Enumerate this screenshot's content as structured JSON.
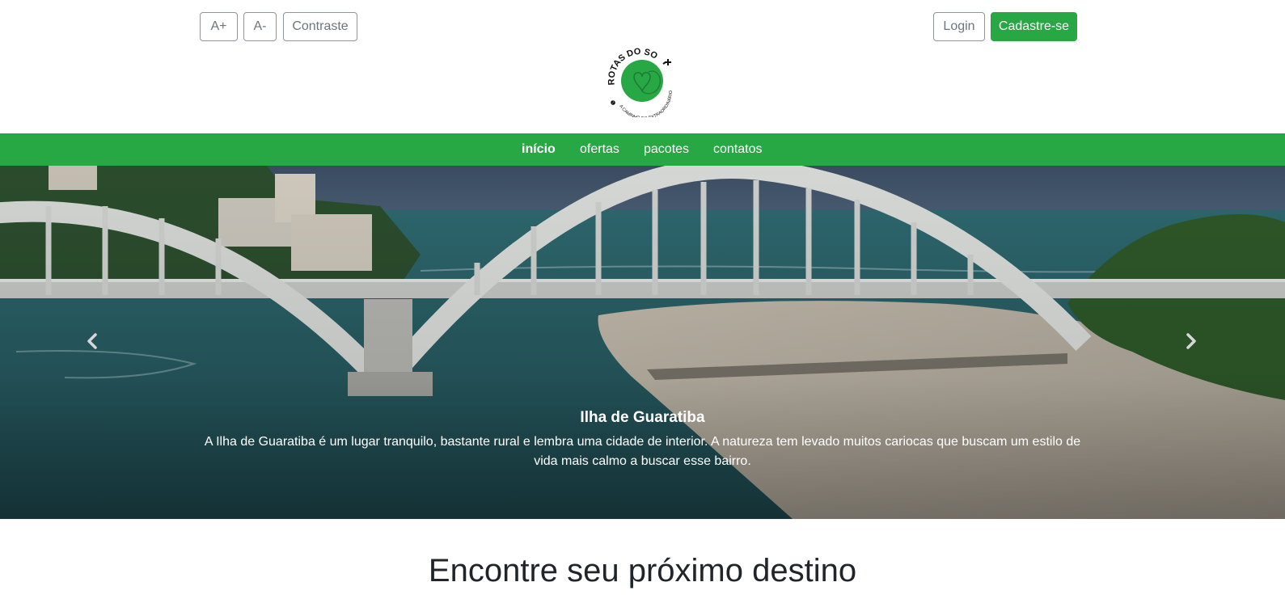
{
  "accessibility": {
    "increase_font_label": "A+",
    "decrease_font_label": "A-",
    "contrast_label": "Contraste"
  },
  "auth": {
    "login_label": "Login",
    "signup_label": "Cadastre-se"
  },
  "logo": {
    "brand_text": "ROTAS DO SOL",
    "tagline_text": "A CAMINHO DO EXTRAORDINÁRIO"
  },
  "nav": {
    "items": [
      {
        "label": "início",
        "active": true
      },
      {
        "label": "ofertas",
        "active": false
      },
      {
        "label": "pacotes",
        "active": false
      },
      {
        "label": "contatos",
        "active": false
      }
    ]
  },
  "carousel": {
    "slide": {
      "title": "Ilha de Guaratiba",
      "text": "A Ilha de Guaratiba é um lugar tranquilo, bastante rural e lembra uma cidade de interior. A natureza tem levado muitos cariocas que buscam um estilo de vida mais calmo a buscar esse bairro."
    },
    "prev_icon": "chevron-left-icon",
    "next_icon": "chevron-right-icon"
  },
  "main": {
    "heading": "Encontre seu próximo destino"
  },
  "colors": {
    "brand_green": "#28a745",
    "text_dark": "#212529",
    "button_border": "#8e959b",
    "button_text": "#6c757d"
  }
}
